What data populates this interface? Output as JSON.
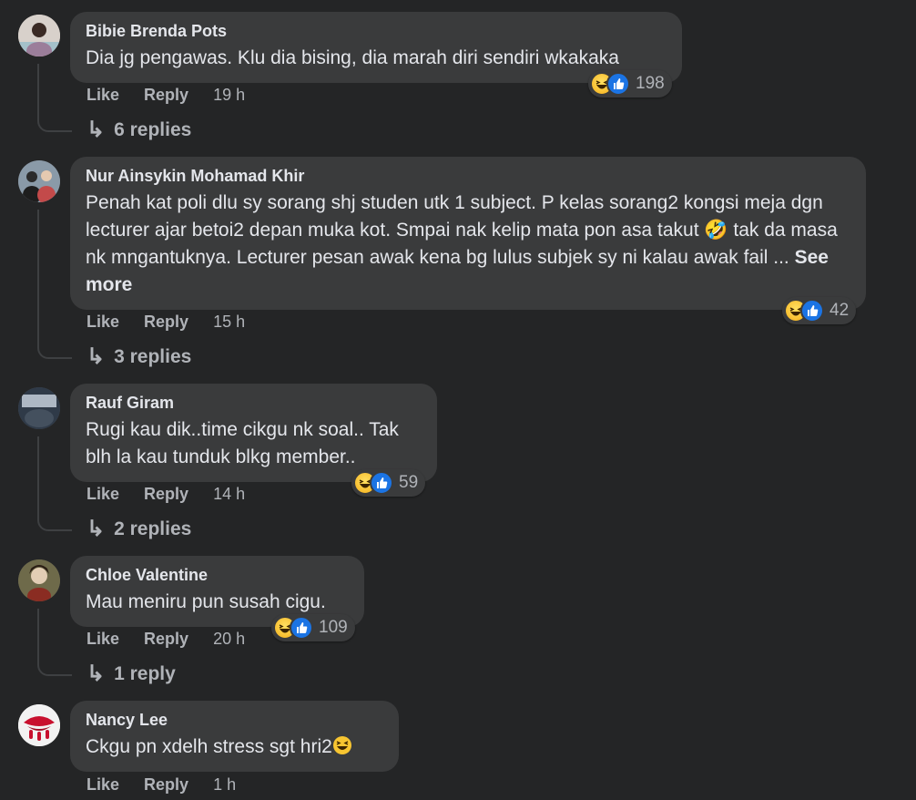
{
  "colors": {
    "background": "#242526",
    "bubble": "#3a3b3c",
    "text_primary": "#e4e6eb",
    "text_secondary": "#b0b3b8",
    "like_blue": "#1b74e4",
    "haha_yellow": "#f7b928"
  },
  "actions": {
    "like": "Like",
    "reply": "Reply"
  },
  "comments": [
    {
      "author": "Bibie Brenda Pots",
      "text": "Dia jg pengawas. Klu dia bising, dia marah diri sendiri wkakaka",
      "time": "19 h",
      "reactions": [
        "haha-icon",
        "like-icon"
      ],
      "reaction_count": "198",
      "replies": "6 replies"
    },
    {
      "author": "Nur Ainsykin Mohamad Khir",
      "text": "Penah kat poli dlu sy sorang shj studen utk 1 subject. P kelas sorang2 kongsi meja dgn lecturer ajar betoi2 depan muka kot. Smpai nak kelip mata pon asa takut 🤣 tak da masa nk mngantuknya. Lecturer pesan awak kena bg lulus subjek sy ni kalau awak fail ...",
      "see_more": "See more",
      "time": "15 h",
      "reactions": [
        "haha-icon",
        "like-icon"
      ],
      "reaction_count": "42",
      "replies": "3 replies"
    },
    {
      "author": "Rauf Giram",
      "text": "Rugi kau dik..time cikgu nk soal.. Tak blh la kau tunduk blkg member..",
      "time": "14 h",
      "reactions": [
        "haha-icon",
        "like-icon"
      ],
      "reaction_count": "59",
      "replies": "2 replies"
    },
    {
      "author": "Chloe Valentine",
      "text": "Mau meniru pun susah cigu.",
      "time": "20 h",
      "reactions": [
        "haha-icon",
        "like-icon"
      ],
      "reaction_count": "109",
      "replies": "1 reply"
    },
    {
      "author": "Nancy Lee",
      "text": "Ckgu pn xdelh stress sgt hri2",
      "time": "1 h"
    }
  ]
}
